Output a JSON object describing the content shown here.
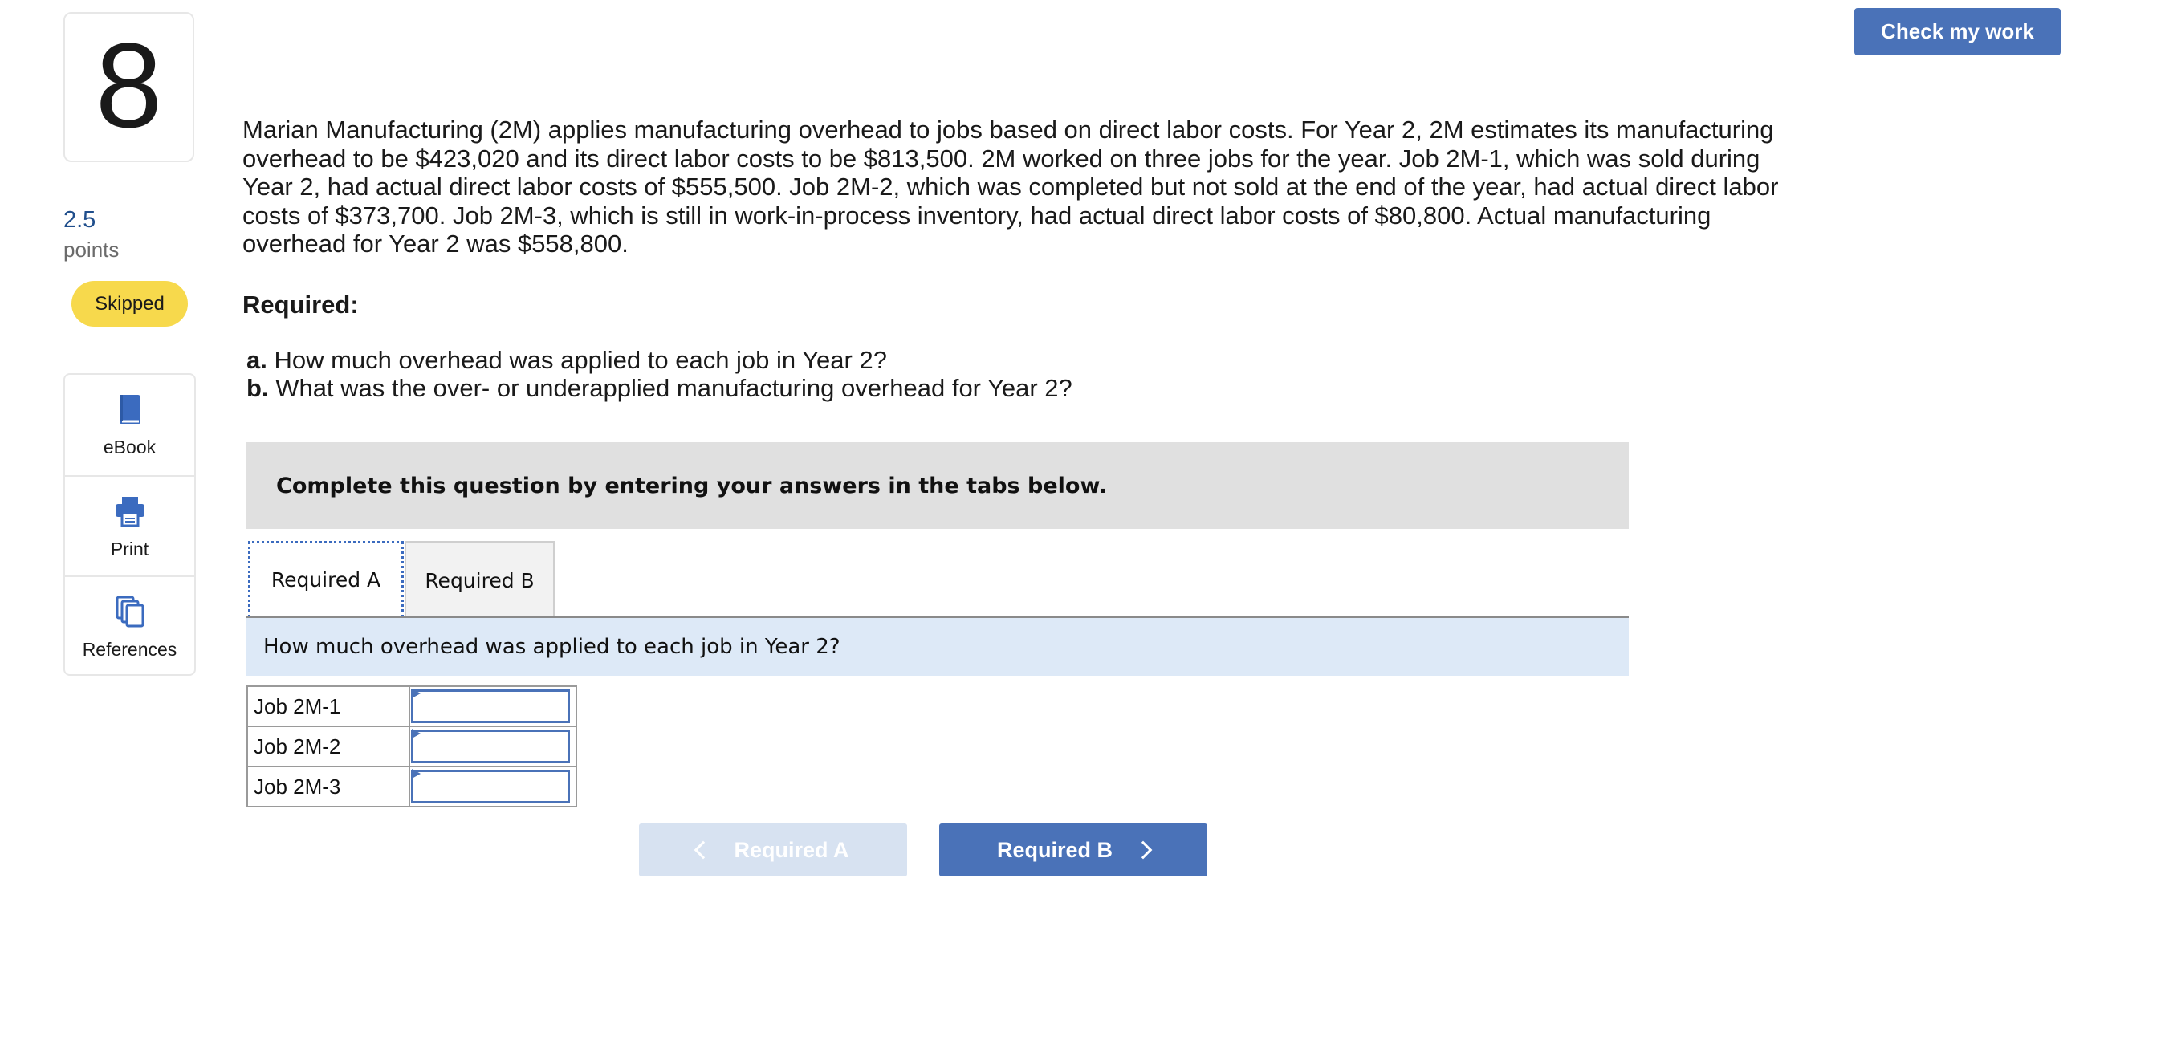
{
  "question": {
    "number": "8",
    "points_value": "2.5",
    "points_label": "points",
    "status": "Skipped",
    "text": "Marian Manufacturing (2M) applies manufacturing overhead to jobs based on direct labor costs. For Year 2, 2M estimates its manufacturing overhead to be $423,020 and its direct labor costs to be $813,500. 2M worked on three jobs for the year. Job 2M-1, which was sold during Year 2, had actual direct labor costs of $555,500. Job 2M-2, which was completed but not sold at the end of the year, had actual direct labor costs of $373,700. Job 2M-3, which is still in work-in-process inventory, had actual direct labor costs of $80,800. Actual manufacturing overhead for Year 2 was $558,800.",
    "required_heading": "Required:",
    "requirements": [
      {
        "letter": "a.",
        "text": "How much overhead was applied to each job in Year 2?"
      },
      {
        "letter": "b.",
        "text": "What was the over- or underapplied manufacturing overhead for Year 2?"
      }
    ]
  },
  "tools": [
    {
      "label": "eBook",
      "icon": "book-icon"
    },
    {
      "label": "Print",
      "icon": "printer-icon"
    },
    {
      "label": "References",
      "icon": "copy-documents-icon"
    }
  ],
  "header": {
    "check_label": "Check my work"
  },
  "instructions": "Complete this question by entering your answers in the tabs below.",
  "tabs": [
    {
      "label": "Required A",
      "active": true
    },
    {
      "label": "Required B",
      "active": false
    }
  ],
  "subquestion": "How much overhead was applied to each job in Year 2?",
  "answer_rows": [
    {
      "label": "Job 2M-1",
      "value": ""
    },
    {
      "label": "Job 2M-2",
      "value": ""
    },
    {
      "label": "Job 2M-3",
      "value": ""
    }
  ],
  "nav": {
    "prev_label": "Required A",
    "next_label": "Required B"
  },
  "colors": {
    "accent": "#4a72b8",
    "skipped_badge": "#f7d94c",
    "banner_bg": "#e0e0e0",
    "subq_bg": "#dde9f7",
    "disabled_btn": "#d7e2f1"
  }
}
